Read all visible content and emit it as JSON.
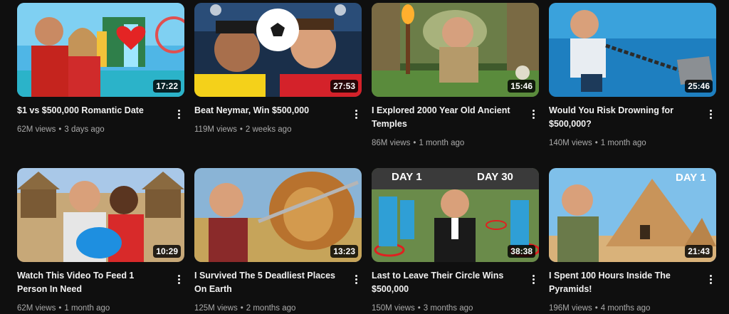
{
  "videos": [
    {
      "title": "$1 vs $500,000 Romantic Date",
      "views": "62M views",
      "age": "3 days ago",
      "duration": "17:22"
    },
    {
      "title": "Beat Neymar, Win $500,000",
      "views": "119M views",
      "age": "2 weeks ago",
      "duration": "27:53"
    },
    {
      "title": "I Explored 2000 Year Old Ancient Temples",
      "views": "86M views",
      "age": "1 month ago",
      "duration": "15:46"
    },
    {
      "title": "Would You Risk Drowning for $500,000?",
      "views": "140M views",
      "age": "1 month ago",
      "duration": "25:46"
    },
    {
      "title": "Watch This Video To Feed 1 Person In Need",
      "views": "62M views",
      "age": "1 month ago",
      "duration": "10:29"
    },
    {
      "title": "I Survived The 5 Deadliest Places On Earth",
      "views": "125M views",
      "age": "2 months ago",
      "duration": "13:23"
    },
    {
      "title": "Last to Leave Their Circle Wins $500,000",
      "views": "150M views",
      "age": "3 months ago",
      "duration": "38:38",
      "thumb_text_left": "DAY 1",
      "thumb_text_right": "DAY 30"
    },
    {
      "title": "I Spent 100 Hours Inside The Pyramids!",
      "views": "196M views",
      "age": "4 months ago",
      "duration": "21:43",
      "thumb_text_right": "DAY 1"
    }
  ],
  "separator": "•",
  "menu_icon": "more-vert-icon"
}
